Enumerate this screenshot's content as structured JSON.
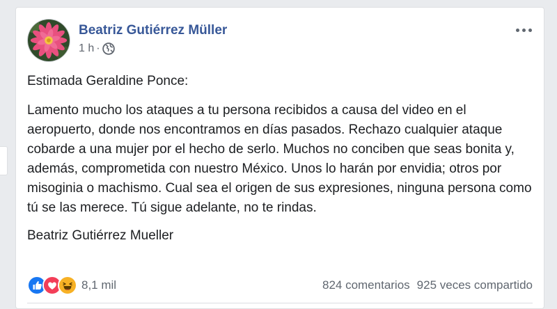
{
  "post": {
    "author": "Beatriz Gutiérrez Müller",
    "time": "1 h",
    "separator": "·",
    "privacy_icon": "globe-icon",
    "more_icon": "more-options-icon",
    "greeting": "Estimada Geraldine Ponce:",
    "text": "Lamento mucho los ataques a tu persona recibidos a causa del video en el aeropuerto, donde nos encontramos en días pasados. Rechazo cualquier ataque cobarde a una mujer por el hecho de serlo. Muchos no conciben que seas bonita y, además, comprometida con nuestro México. Unos lo harán por envidia; otros por misoginia o machismo. Cual sea el origen de sus expresiones, ninguna persona como tú se las merece. Tú sigue adelante, no te rindas.",
    "signature": "Beatriz Gutiérrez Mueller"
  },
  "reactions": {
    "icons": [
      "like-icon",
      "love-icon",
      "haha-icon"
    ],
    "count": "8,1 mil"
  },
  "stats": {
    "comments": "824 comentarios",
    "shares": "925 veces compartido"
  },
  "colors": {
    "name": "#385898",
    "like": "#1877f2",
    "love": "#f33e58",
    "haha": "#f7b125"
  }
}
